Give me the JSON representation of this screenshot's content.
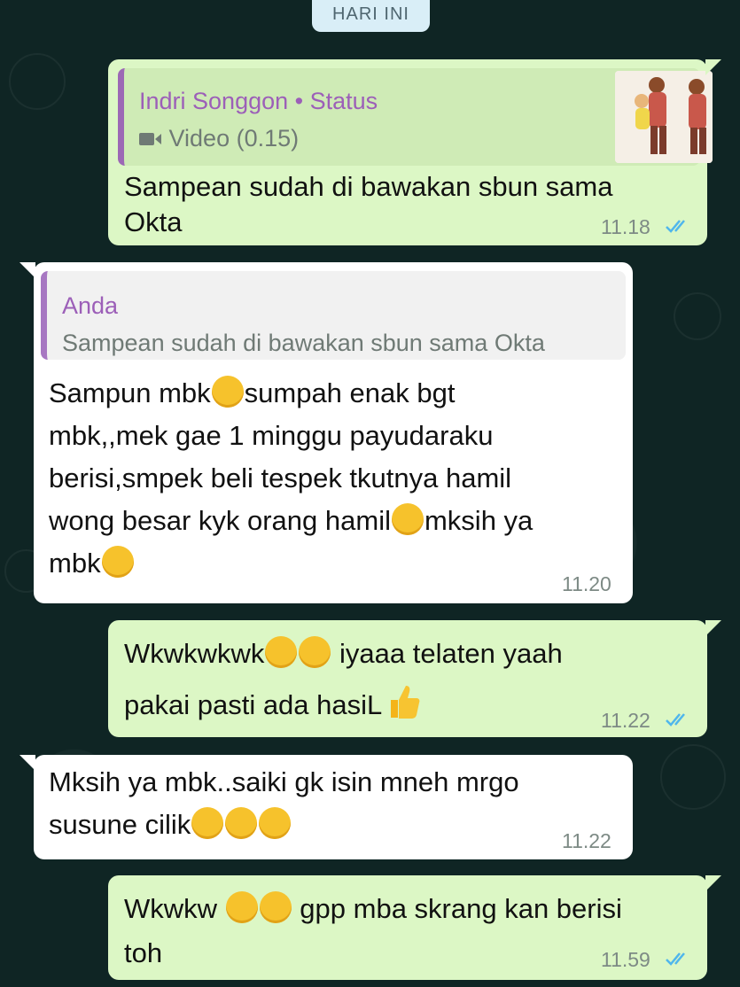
{
  "date_chip": "HARI INI",
  "messages": [
    {
      "direction": "outgoing",
      "reply": {
        "name": "Indri Songgon • Status",
        "text": "Video (0.15)",
        "icon": "video-camera-icon"
      },
      "lines": [
        "Sampean sudah di bawakan sbun sama",
        "Okta"
      ],
      "time": "11.18",
      "read": true
    },
    {
      "direction": "incoming",
      "reply": {
        "name": "Anda",
        "text": "Sampean sudah di bawakan sbun sama Okta"
      },
      "lines": [
        "Sampun mbk",
        "sumpah enak bgt",
        "mbk,,mek gae 1 minggu payudaraku",
        "berisi,smpek beli tespek tkutnya hamil",
        "wong besar kyk orang hamil",
        "mksih ya",
        "mbk"
      ],
      "time": "11.20"
    },
    {
      "direction": "outgoing",
      "lines": [
        "Wkwkwkwk",
        "iyaaa telaten yaah",
        "pakai pasti ada hasiL"
      ],
      "time": "11.22",
      "read": true
    },
    {
      "direction": "incoming",
      "lines": [
        "Mksih ya mbk..saiki gk isin mneh mrgo",
        "susune cilik"
      ],
      "time": "11.22"
    },
    {
      "direction": "outgoing",
      "lines": [
        "Wkwkw",
        "gpp mba skrang kan berisi",
        "toh"
      ],
      "time": "11.59",
      "read": true
    }
  ],
  "colors": {
    "outgoing_bubble": "#dcf7c5",
    "incoming_bubble": "#ffffff",
    "read_ticks": "#4fb6ec",
    "quote_name": "#9c5fb8"
  }
}
